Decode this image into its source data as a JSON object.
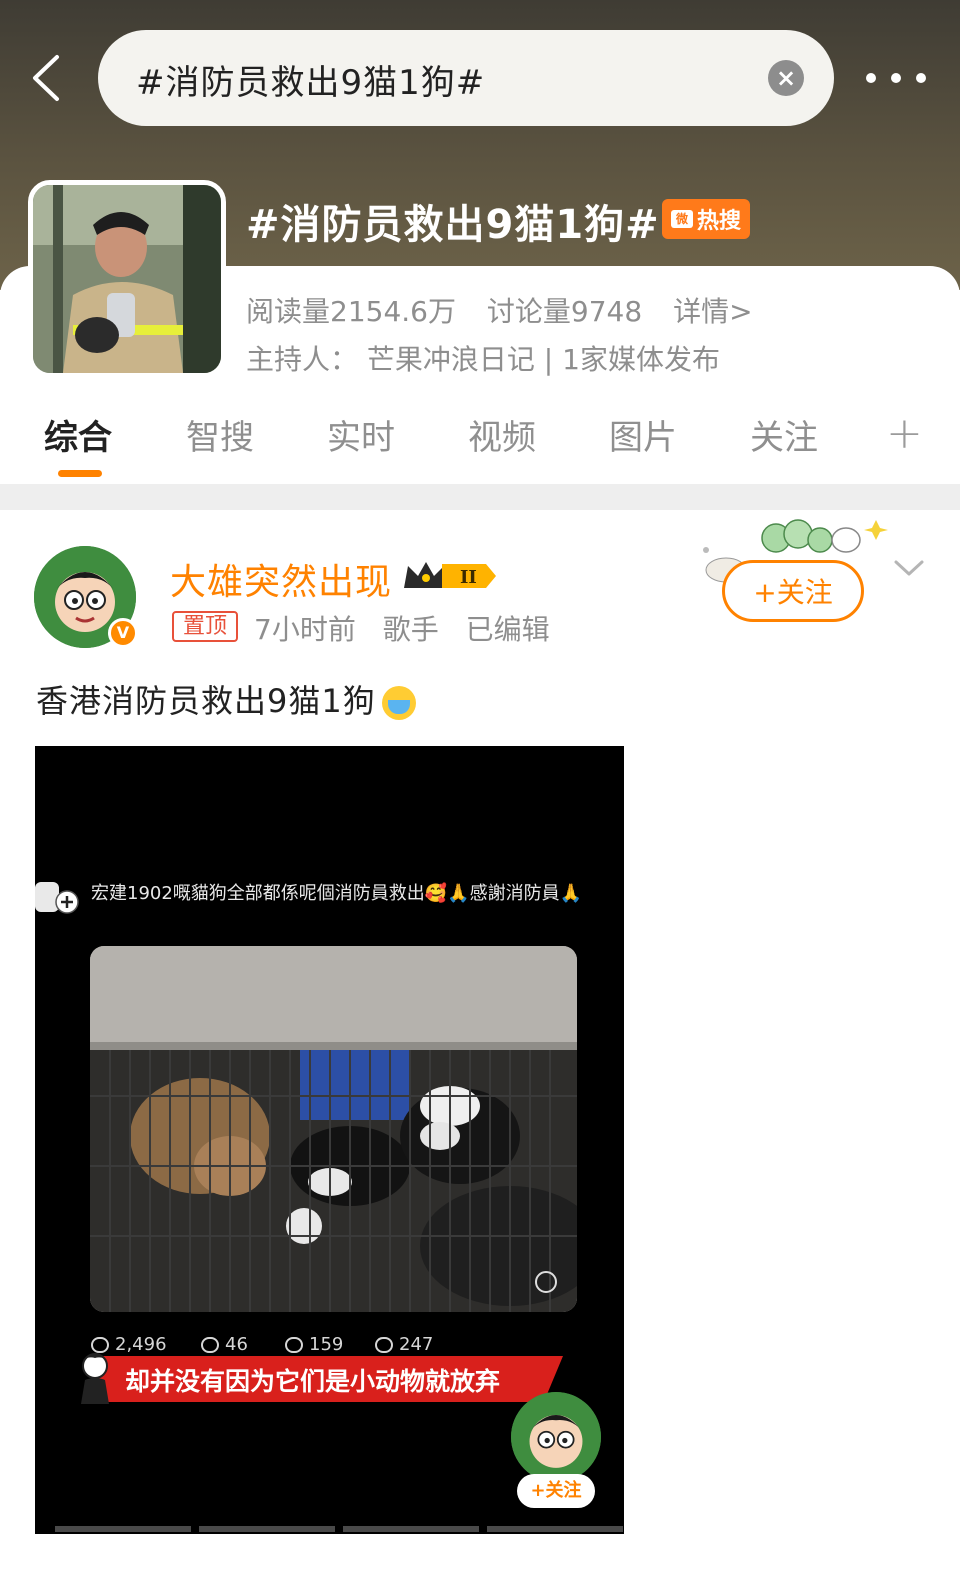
{
  "search": {
    "query": "#消防员救出9猫1狗#",
    "clear_icon": "close-circle-icon"
  },
  "topic": {
    "title": "#消防员救出9猫1狗#",
    "hot_badge": "热搜",
    "reads": "阅读量2154.6万",
    "discussions": "讨论量9748",
    "details": "详情>",
    "host": "主持人：  芒果冲浪日记 | 1家媒体发布"
  },
  "tabs": [
    {
      "label": "综合",
      "active": true
    },
    {
      "label": "智搜"
    },
    {
      "label": "实时"
    },
    {
      "label": "视频"
    },
    {
      "label": "图片"
    },
    {
      "label": "关注"
    }
  ],
  "post": {
    "username": "大雄突然出现",
    "level_badge": "II",
    "pinned_label": "置顶",
    "time": "7小时前",
    "source": "歌手",
    "edited": "已编辑",
    "follow_label": "+关注",
    "text": "香港消防员救出9猫1狗"
  },
  "video": {
    "caption": "宏建1902嘅貓狗全部都係呢個消防員救出🥰🙏感謝消防員🙏",
    "likes": "2,496",
    "comments": "46",
    "reposts": "159",
    "shares": "247",
    "subtitle": "却并没有因为它们是小动物就放弃",
    "follow_label": "+关注"
  },
  "colors": {
    "accent": "#ff8200",
    "hot": "#ff7a1a",
    "pinned": "#e8513a",
    "subtitle_bg": "#d9201c"
  }
}
